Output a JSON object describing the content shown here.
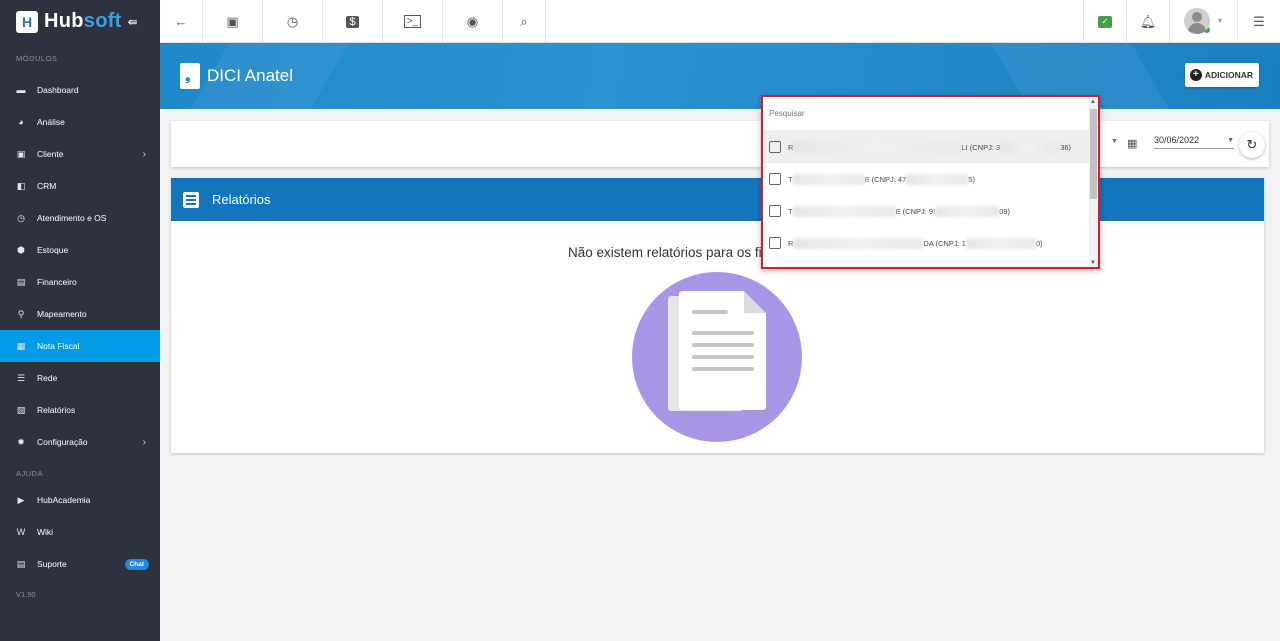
{
  "app": {
    "logo_main": "Hub",
    "logo_accent": "soft",
    "logo_letter": "H"
  },
  "sidebar": {
    "section_modules": "MÓDULOS",
    "items": [
      {
        "label": "Dashboard",
        "icon": "dashboard-icon"
      },
      {
        "label": "Análise",
        "icon": "pie-chart-icon"
      },
      {
        "label": "Cliente",
        "icon": "contact-card-icon",
        "has_children": true
      },
      {
        "label": "CRM",
        "icon": "crm-icon"
      },
      {
        "label": "Atendimento e OS",
        "icon": "calendar-clock-icon"
      },
      {
        "label": "Estoque",
        "icon": "box-icon"
      },
      {
        "label": "Financeiro",
        "icon": "money-icon"
      },
      {
        "label": "Mapeamento",
        "icon": "map-pin-icon"
      },
      {
        "label": "Nota Fiscal",
        "icon": "invoice-icon",
        "active": true
      },
      {
        "label": "Rede",
        "icon": "network-icon"
      },
      {
        "label": "Relatórios",
        "icon": "report-icon"
      },
      {
        "label": "Configuração",
        "icon": "gear-icon",
        "has_children": true
      }
    ],
    "section_help": "AJUDA",
    "help_items": [
      {
        "label": "HubAcademia",
        "icon": "youtube-icon"
      },
      {
        "label": "Wiki",
        "icon": "wikipedia-icon"
      },
      {
        "label": "Suporte",
        "icon": "chat-icon",
        "badge": "Chat"
      }
    ],
    "version": "V1.90"
  },
  "topbar": {
    "icons": [
      "back-arrow-icon",
      "contact-card-icon",
      "calendar-clock-icon",
      "dollar-icon",
      "terminal-icon",
      "eye-icon",
      "search-icon"
    ],
    "right_icons": [
      "chat-check-icon",
      "bell-icon",
      "avatar",
      "menu-list-icon"
    ]
  },
  "header": {
    "title": "DICI Anatel",
    "add_button": "ADICIONAR"
  },
  "filters": {
    "end_date": "30/06/2022"
  },
  "reports": {
    "title": "Relatórios",
    "empty_message": "Não existem relatórios para os fi"
  },
  "dropdown": {
    "search_placeholder": "Pesquisar",
    "items": [
      {
        "prefix": "R",
        "suffix": "LI (CNPJ: 3",
        "tail": "36)"
      },
      {
        "prefix": "T",
        "suffix": "E (CNPJ: 47",
        "tail": "5)"
      },
      {
        "prefix": "T",
        "suffix": "E (CNPJ: 9!",
        "tail": "09)"
      },
      {
        "prefix": "R",
        "suffix": "DA (CNPJ: 1",
        "tail": "0)"
      }
    ]
  },
  "colors": {
    "sidebar_bg": "#2d323e",
    "active": "#039be5",
    "header": "#1e88c8",
    "reports_header": "#1475bd",
    "highlight_border": "#d81b2a"
  }
}
